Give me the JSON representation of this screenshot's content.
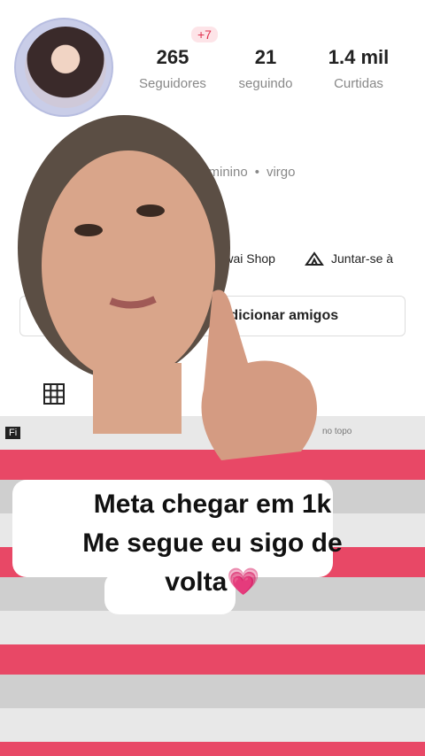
{
  "profile": {
    "new_badge": "+7",
    "stats": [
      {
        "value": "265",
        "label": "Seguidores"
      },
      {
        "value": "21",
        "label": "seguindo"
      },
      {
        "value": "1.4 mil",
        "label": "Curtidas"
      }
    ],
    "gender": "Feminino",
    "sign": "virgo",
    "links": [
      {
        "label": "Kwai Shop",
        "icon": "shop-icon"
      },
      {
        "label": "Juntar-se à",
        "icon": "tent-icon"
      }
    ],
    "add_friends_label": "Adicionar amigos"
  },
  "tabs": [
    {
      "icon": "grid-icon"
    }
  ],
  "overlay_labels": {
    "left": "Fi",
    "right": "no topo"
  },
  "caption": {
    "line1": "Meta chegar em 1k",
    "line2": "Me segue eu sigo de",
    "line3": "volta",
    "emoji": "💗"
  },
  "colors": {
    "accent": "#e0304e",
    "sweater_pink": "#e84866"
  }
}
